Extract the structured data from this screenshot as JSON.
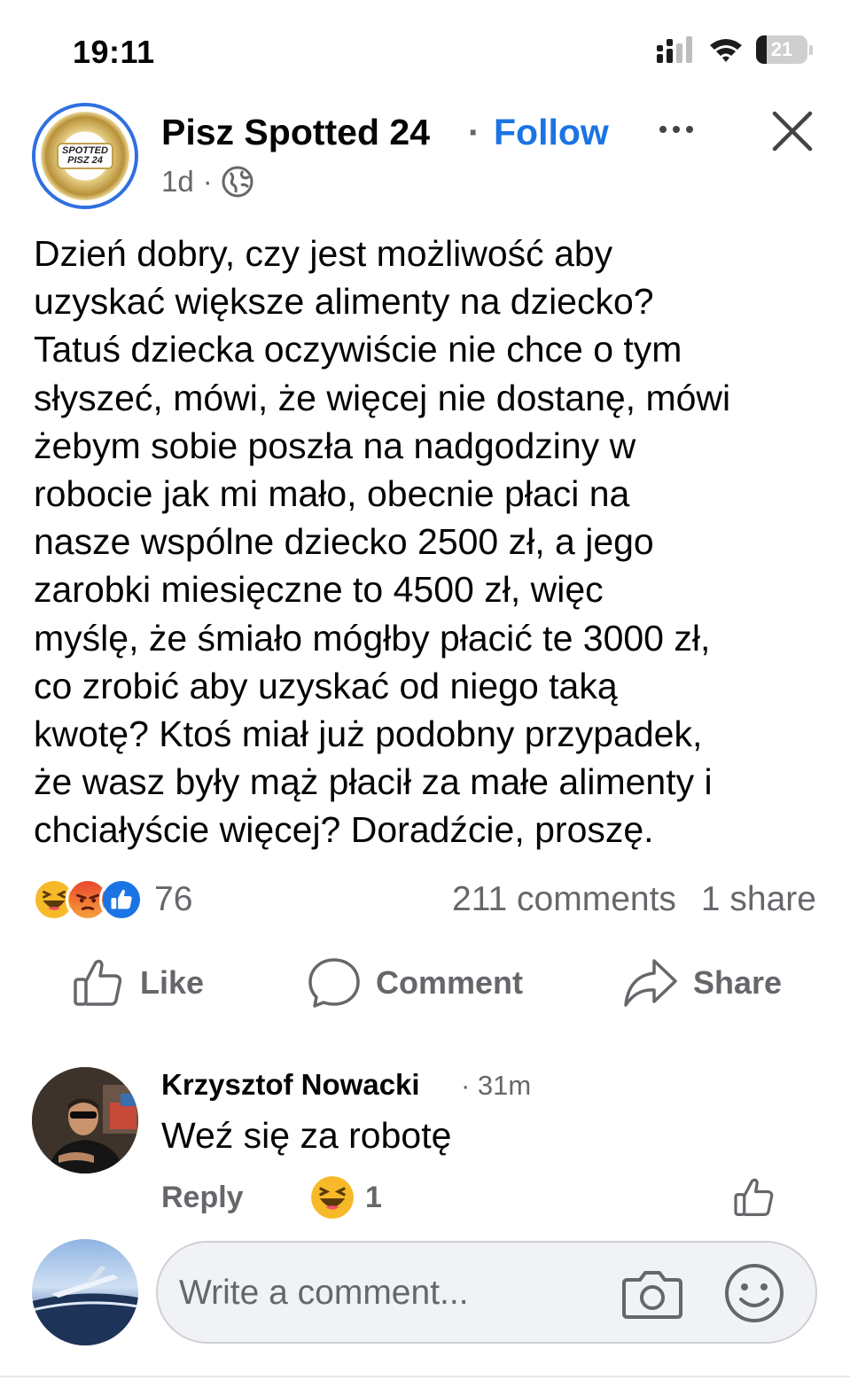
{
  "status_bar": {
    "time": "19:11",
    "battery_level": "21",
    "battery_fraction": 0.21
  },
  "post": {
    "page_avatar": {
      "logo_line1": "SPOTTED",
      "logo_line2": "PISZ 24"
    },
    "page_name": "Pisz Spotted 24",
    "separator": "·",
    "follow_label": "Follow",
    "time_ago": "1d",
    "meta_dot": "·",
    "audience_icon": "globe-icon",
    "text_lines": [
      "Dzień dobry, czy jest możliwość aby",
      "uzyskać większe alimenty na dziecko?",
      "Tatuś dziecka oczywiście nie chce o tym",
      "słyszeć, mówi, że więcej nie dostanę, mówi",
      "żebym sobie poszła na nadgodziny w",
      "robocie jak mi mało, obecnie płaci na",
      "nasze wspólne dziecko 2500 zł, a jego",
      "zarobki miesięczne to 4500 zł,  więc",
      "myślę, że śmiało mógłby płacić te 3000 zł,",
      "co zrobić aby uzyskać od niego taką",
      "kwotę? Ktoś miał już podobny przypadek,",
      "że wasz były mąż płacił za małe alimenty i",
      "chciałyście więcej? Doradźcie, proszę."
    ],
    "reactions": {
      "icons": [
        "haha-icon",
        "angry-icon",
        "like-icon"
      ],
      "count": "76"
    },
    "comments_count": "211 comments",
    "shares_count": "1 share"
  },
  "actions": {
    "like": "Like",
    "comment": "Comment",
    "share": "Share"
  },
  "comment": {
    "author": "Krzysztof Nowacki",
    "time": "· 31m",
    "text": "Weź się za robotę",
    "reply_label": "Reply",
    "reaction_icon": "haha-icon",
    "reaction_count": "1"
  },
  "composer": {
    "placeholder": "Write a comment..."
  },
  "colors": {
    "accent": "#1b74e4",
    "muted_text": "#65676b",
    "avatar_ring": "#2f6fe0",
    "input_bg": "#f0f2f5"
  }
}
